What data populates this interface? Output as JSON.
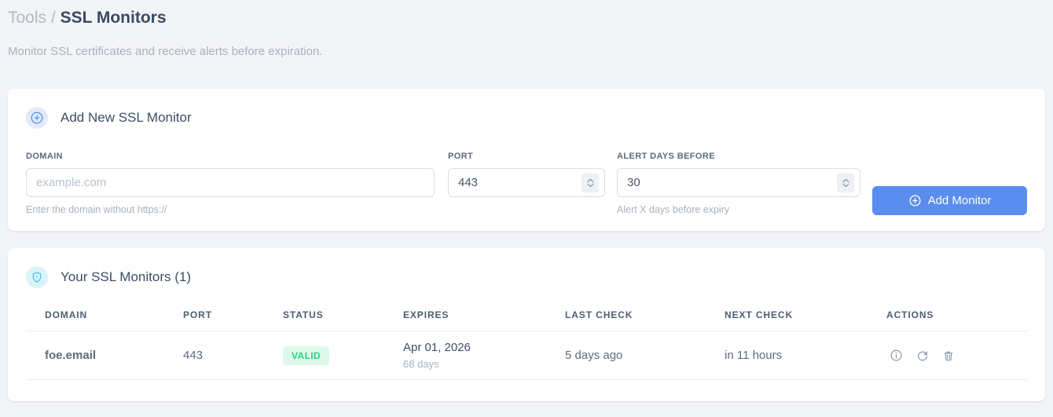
{
  "breadcrumb": {
    "section": "Tools",
    "separator": "/",
    "current": "SSL Monitors"
  },
  "subtitle": "Monitor SSL certificates and receive alerts before expiration.",
  "add_monitor_card": {
    "title": "Add New SSL Monitor",
    "icon": "plus-circle-icon",
    "fields": {
      "domain": {
        "label": "DOMAIN",
        "placeholder": "example.com",
        "helper": "Enter the domain without https://"
      },
      "port": {
        "label": "PORT",
        "value": "443"
      },
      "alert_days": {
        "label": "ALERT DAYS BEFORE",
        "value": "30",
        "helper": "Alert X days before expiry"
      }
    },
    "submit_label": "Add Monitor"
  },
  "monitors_card": {
    "title": "Your SSL Monitors (1)",
    "icon": "shield-icon",
    "table": {
      "headers": [
        "DOMAIN",
        "PORT",
        "STATUS",
        "EXPIRES",
        "LAST CHECK",
        "NEXT CHECK",
        "ACTIONS"
      ],
      "rows": [
        {
          "domain": "foe.email",
          "port": "443",
          "status": "VALID",
          "expires_date": "Apr 01, 2026",
          "expires_days": "68 days",
          "last_check": "5 days ago",
          "next_check": "in 11 hours",
          "actions": [
            "info-icon",
            "refresh-icon",
            "trash-icon"
          ]
        }
      ]
    }
  },
  "colors": {
    "accent_blue": "#5a8dee",
    "accent_cyan": "#33c5d8",
    "valid_text": "#2fd180",
    "valid_bg": "#ddf9eb",
    "page_bg": "#f3f4f6"
  }
}
